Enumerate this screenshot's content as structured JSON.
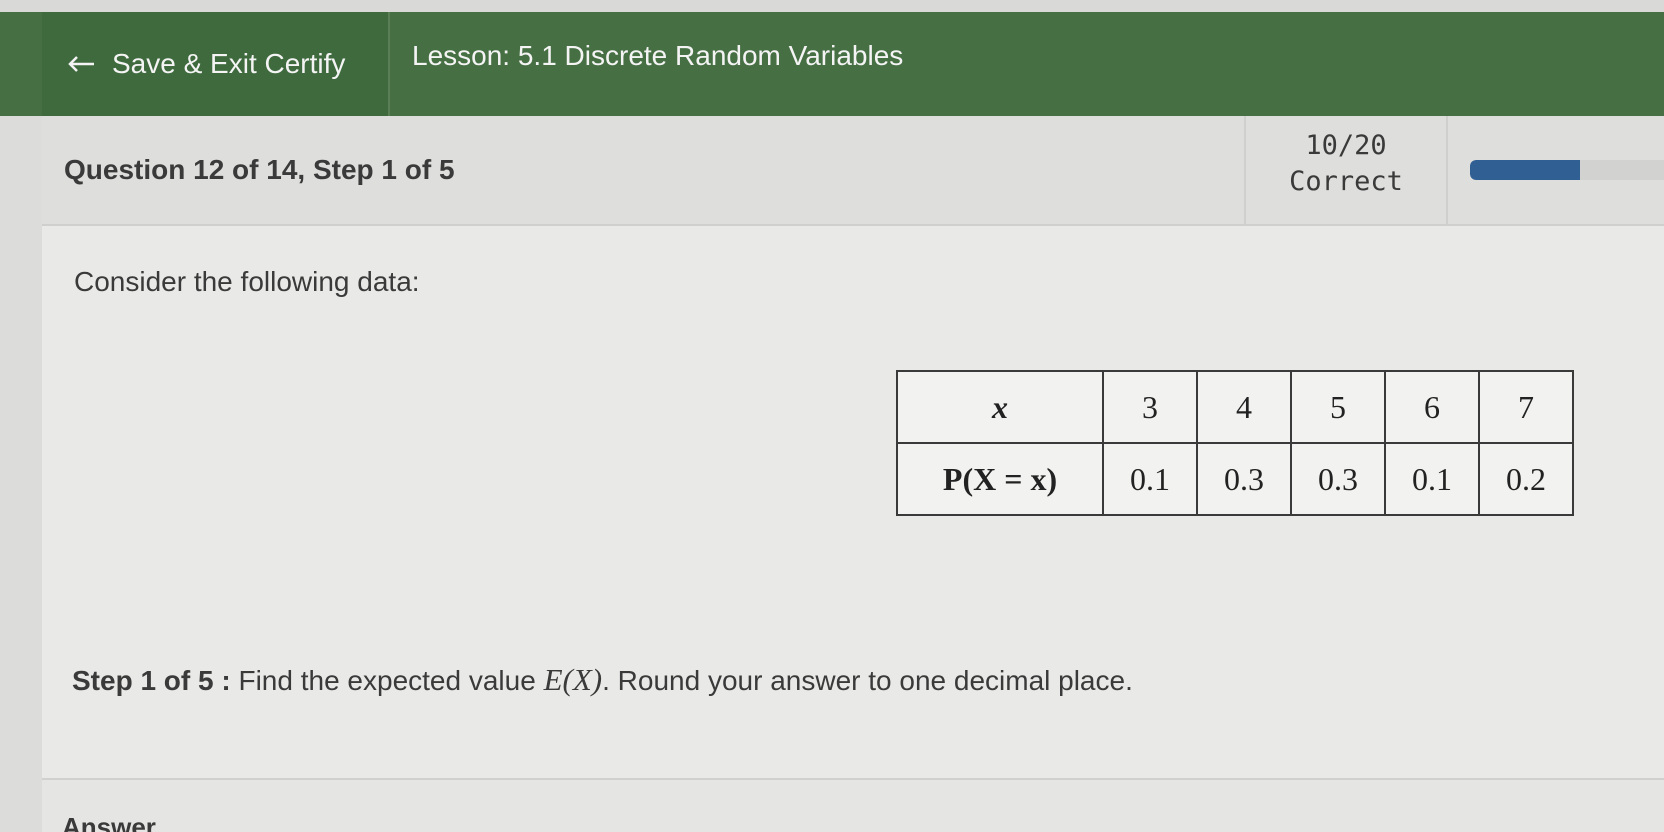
{
  "header": {
    "save_exit_label": "Save & Exit Certify",
    "lesson_title": "Lesson: 5.1 Discrete Random Variables",
    "background_color": "#466f43"
  },
  "question_bar": {
    "question_label": "Question 12 of 14, Step 1 of 5",
    "score": "10/20",
    "score_label": "Correct",
    "progress_fraction": 0.5,
    "progress_color": "#2f5f93"
  },
  "content": {
    "intro": "Consider the following data:",
    "table": {
      "row_headers": [
        "x",
        "P(X = x)"
      ],
      "x_values": [
        "3",
        "4",
        "5",
        "6",
        "7"
      ],
      "p_values": [
        "0.1",
        "0.3",
        "0.3",
        "0.1",
        "0.2"
      ]
    },
    "step": {
      "prefix": "Step 1 of 5 :",
      "text_before": " Find the expected value ",
      "math": "E(X)",
      "text_after": ". Round your answer to one decimal place."
    }
  },
  "answer": {
    "label": "Answer"
  }
}
